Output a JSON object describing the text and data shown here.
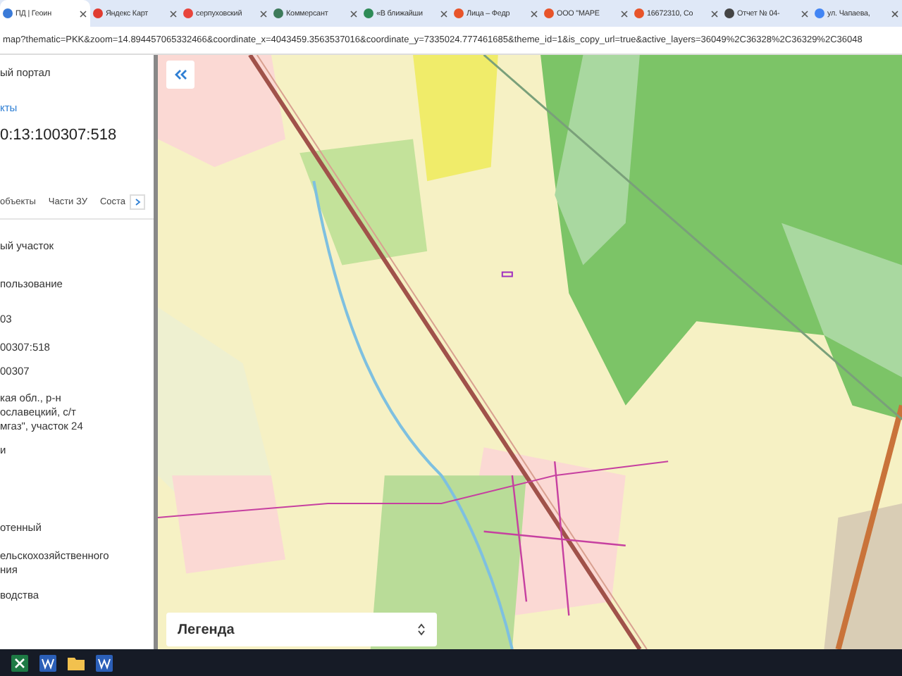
{
  "browser": {
    "tabs": [
      {
        "title": "ПД | Геоин",
        "selected": true,
        "color": "#3b7bd8"
      },
      {
        "title": "Яндекс Карт",
        "selected": false,
        "color": "#e03c31"
      },
      {
        "title": "серпуховский",
        "selected": false,
        "color": "#e8453c"
      },
      {
        "title": "Коммерсант",
        "selected": false,
        "color": "#3d7a5a"
      },
      {
        "title": "«В ближайши",
        "selected": false,
        "color": "#2e8b57"
      },
      {
        "title": "Лица – Федр",
        "selected": false,
        "color": "#e8542a"
      },
      {
        "title": "ООО \"МАРЕ",
        "selected": false,
        "color": "#e8542a"
      },
      {
        "title": "16672310, Со",
        "selected": false,
        "color": "#e8542a"
      },
      {
        "title": "Отчет № 04-",
        "selected": false,
        "color": "#444444"
      },
      {
        "title": "ул. Чапаева,",
        "selected": false,
        "color": "#4285f4"
      }
    ],
    "url": "map?thematic=PKK&zoom=14.894457065332466&coordinate_x=4043459.3563537016&coordinate_y=7335024.777461685&theme_id=1&is_copy_url=true&active_layers=36049%2C36328%2C36329%2C36048"
  },
  "sidebar": {
    "portal": "ый портал",
    "link": "кты",
    "cadastral_number": "0:13:100307:518",
    "tabs": [
      {
        "label": "объекты",
        "selected": false
      },
      {
        "label": "Части ЗУ",
        "selected": false
      },
      {
        "label": "Соста",
        "selected": false
      }
    ],
    "fields": [
      "ый участок",
      "пользование",
      "03",
      "00307:518",
      "00307",
      "кая обл., р-н\nославецкий, с/т\nмгаз\", участок 24",
      "и",
      "отенный",
      "ельскохозяйственного\nния",
      "водства"
    ]
  },
  "map": {
    "legend": "Легенда"
  }
}
